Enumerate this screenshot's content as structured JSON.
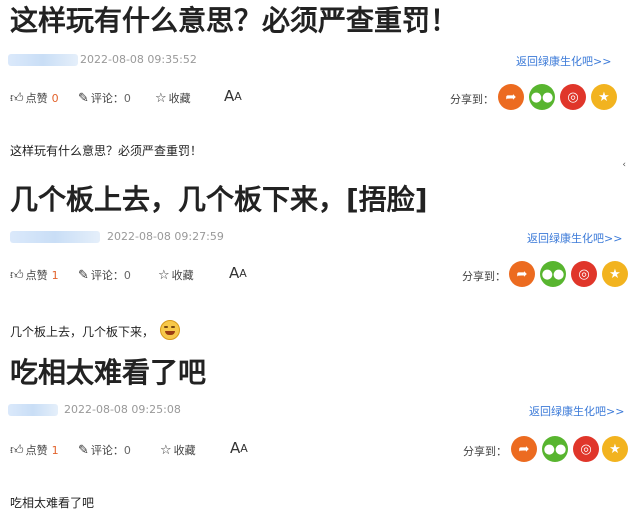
{
  "posts": [
    {
      "title": "这样玩有什么意思？必须严查重罚！",
      "timestamp": "2022-08-08 09:35:52",
      "return_link": "返回绿康生化吧>>",
      "like_label": "点赞",
      "like_count": "0",
      "comment_label": "评论：",
      "comment_count": "0",
      "fav_label": "收藏",
      "font_label": "A",
      "font_label_small": "A",
      "share_label": "分享到：",
      "body": "这样玩有什么意思？必须严查重罚！"
    },
    {
      "title": "几个板上去，几个板下来，[捂脸]",
      "timestamp": "2022-08-08 09:27:59",
      "return_link": "返回绿康生化吧>>",
      "like_label": "点赞",
      "like_count": "1",
      "comment_label": "评论：",
      "comment_count": "0",
      "fav_label": "收藏",
      "font_label": "A",
      "font_label_small": "A",
      "share_label": "分享到：",
      "body": "几个板上去，几个板下来，"
    },
    {
      "title": "吃相太难看了吧",
      "timestamp": "2022-08-08 09:25:08",
      "return_link": "返回绿康生化吧>>",
      "like_label": "点赞",
      "like_count": "1",
      "comment_label": "评论：",
      "comment_count": "0",
      "fav_label": "收藏",
      "font_label": "A",
      "font_label_small": "A",
      "share_label": "分享到：",
      "body": "吃相太难看了吧"
    }
  ],
  "icons": {
    "like": "thumbs-up-icon",
    "comment": "edit-comment-icon",
    "favorite": "star-outline-icon",
    "share_targets": [
      "weibo-wave-icon",
      "wechat-icon",
      "sina-weibo-icon",
      "favorite-star-icon"
    ]
  },
  "colors": {
    "link": "#3b7ad8",
    "count": "#e2632c",
    "share_orange": "#ec6b20",
    "share_green": "#58b52f",
    "share_red": "#e0362a",
    "share_yellow": "#f2b31f"
  }
}
